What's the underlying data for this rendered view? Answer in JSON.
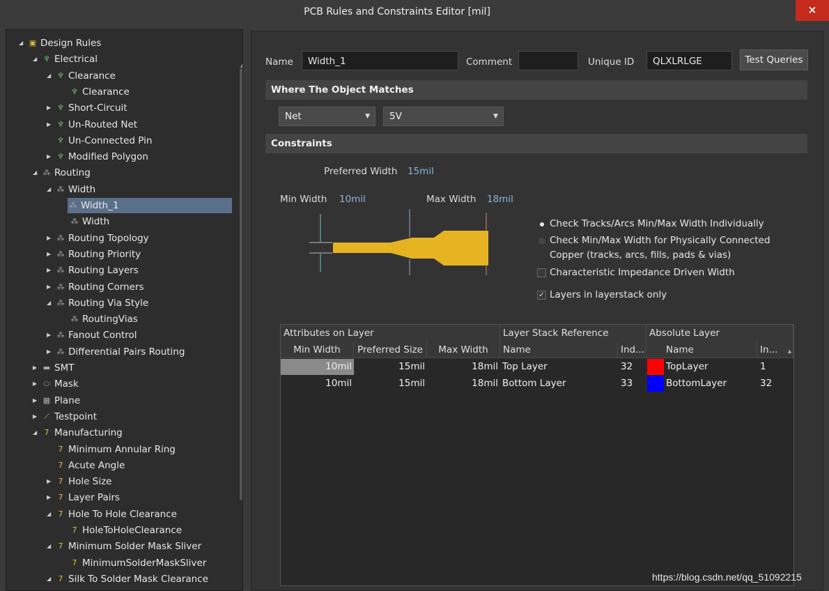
{
  "window": {
    "title": "PCB Rules and Constraints Editor [mil]",
    "close_glyph": "×"
  },
  "tree": [
    {
      "label": "Design Rules",
      "depth": 0,
      "arrow": "open",
      "icon": "folder-rules-icon",
      "glyph": "▣"
    },
    {
      "label": "Electrical",
      "depth": 1,
      "arrow": "open",
      "icon": "electrical-rule-icon",
      "glyph": "♆"
    },
    {
      "label": "Clearance",
      "depth": 2,
      "arrow": "open",
      "icon": "electrical-rule-icon",
      "glyph": "♆"
    },
    {
      "label": "Clearance",
      "depth": 3,
      "arrow": "none",
      "icon": "electrical-rule-icon",
      "glyph": "♆"
    },
    {
      "label": "Short-Circuit",
      "depth": 2,
      "arrow": "closed",
      "icon": "electrical-rule-icon",
      "glyph": "♆"
    },
    {
      "label": "Un-Routed Net",
      "depth": 2,
      "arrow": "closed",
      "icon": "electrical-rule-icon",
      "glyph": "♆"
    },
    {
      "label": "Un-Connected Pin",
      "depth": 2,
      "arrow": "none",
      "icon": "electrical-rule-icon",
      "glyph": "♆"
    },
    {
      "label": "Modified Polygon",
      "depth": 2,
      "arrow": "closed",
      "icon": "electrical-rule-icon",
      "glyph": "♆"
    },
    {
      "label": "Routing",
      "depth": 1,
      "arrow": "open",
      "icon": "routing-rule-icon",
      "glyph": "⁂"
    },
    {
      "label": "Width",
      "depth": 2,
      "arrow": "open",
      "icon": "routing-rule-icon",
      "glyph": "⁂"
    },
    {
      "label": "Width_1",
      "depth": 3,
      "arrow": "none",
      "icon": "routing-rule-icon",
      "glyph": "⁂",
      "selected": true
    },
    {
      "label": "Width",
      "depth": 3,
      "arrow": "none",
      "icon": "routing-rule-icon",
      "glyph": "⁂"
    },
    {
      "label": "Routing Topology",
      "depth": 2,
      "arrow": "closed",
      "icon": "routing-rule-icon",
      "glyph": "⁂"
    },
    {
      "label": "Routing Priority",
      "depth": 2,
      "arrow": "closed",
      "icon": "routing-rule-icon",
      "glyph": "⁂"
    },
    {
      "label": "Routing Layers",
      "depth": 2,
      "arrow": "closed",
      "icon": "routing-rule-icon",
      "glyph": "⁂"
    },
    {
      "label": "Routing Corners",
      "depth": 2,
      "arrow": "closed",
      "icon": "routing-rule-icon",
      "glyph": "⁂"
    },
    {
      "label": "Routing Via Style",
      "depth": 2,
      "arrow": "open",
      "icon": "routing-rule-icon",
      "glyph": "⁂"
    },
    {
      "label": "RoutingVias",
      "depth": 3,
      "arrow": "none",
      "icon": "routing-rule-icon",
      "glyph": "⁂"
    },
    {
      "label": "Fanout Control",
      "depth": 2,
      "arrow": "closed",
      "icon": "routing-rule-icon",
      "glyph": "⁂"
    },
    {
      "label": "Differential Pairs Routing",
      "depth": 2,
      "arrow": "closed",
      "icon": "routing-rule-icon",
      "glyph": "⁂"
    },
    {
      "label": "SMT",
      "depth": 1,
      "arrow": "closed",
      "icon": "smt-rule-icon",
      "glyph": "▬"
    },
    {
      "label": "Mask",
      "depth": 1,
      "arrow": "closed",
      "icon": "mask-rule-icon",
      "glyph": "⬭"
    },
    {
      "label": "Plane",
      "depth": 1,
      "arrow": "closed",
      "icon": "plane-rule-icon",
      "glyph": "▦"
    },
    {
      "label": "Testpoint",
      "depth": 1,
      "arrow": "closed",
      "icon": "testpoint-rule-icon",
      "glyph": "⟋"
    },
    {
      "label": "Manufacturing",
      "depth": 1,
      "arrow": "open",
      "icon": "manufacturing-rule-icon",
      "glyph": "7"
    },
    {
      "label": "Minimum Annular Ring",
      "depth": 2,
      "arrow": "none",
      "icon": "manufacturing-rule-icon",
      "glyph": "7"
    },
    {
      "label": "Acute Angle",
      "depth": 2,
      "arrow": "none",
      "icon": "manufacturing-rule-icon",
      "glyph": "7"
    },
    {
      "label": "Hole Size",
      "depth": 2,
      "arrow": "closed",
      "icon": "manufacturing-rule-icon",
      "glyph": "7"
    },
    {
      "label": "Layer Pairs",
      "depth": 2,
      "arrow": "closed",
      "icon": "manufacturing-rule-icon",
      "glyph": "7"
    },
    {
      "label": "Hole To Hole Clearance",
      "depth": 2,
      "arrow": "open",
      "icon": "manufacturing-rule-icon",
      "glyph": "7"
    },
    {
      "label": "HoleToHoleClearance",
      "depth": 3,
      "arrow": "none",
      "icon": "manufacturing-rule-icon",
      "glyph": "7"
    },
    {
      "label": "Minimum Solder Mask Sliver",
      "depth": 2,
      "arrow": "open",
      "icon": "manufacturing-rule-icon",
      "glyph": "7"
    },
    {
      "label": "MinimumSolderMaskSliver",
      "depth": 3,
      "arrow": "none",
      "icon": "manufacturing-rule-icon",
      "glyph": "7"
    },
    {
      "label": "Silk To Solder Mask Clearance",
      "depth": 2,
      "arrow": "open",
      "icon": "manufacturing-rule-icon",
      "glyph": "7"
    }
  ],
  "header": {
    "name_label": "Name",
    "name_value": "Width_1",
    "comment_label": "Comment",
    "comment_value": "",
    "uid_label": "Unique ID",
    "uid_value": "QLXLRLGE",
    "test_queries": "Test Queries"
  },
  "match": {
    "title": "Where The Object Matches",
    "kind": "Net",
    "value": "5V"
  },
  "constraints": {
    "title": "Constraints",
    "preferred_label": "Preferred Width",
    "preferred_value": "15mil",
    "min_label": "Min Width",
    "min_value": "10mil",
    "max_label": "Max Width",
    "max_value": "18mil",
    "trace_color": "#e6b422",
    "options": [
      {
        "type": "radio",
        "checked": true,
        "text": "Check Tracks/Arcs Min/Max Width Individually"
      },
      {
        "type": "radio",
        "checked": false,
        "text": "Check Min/Max Width for Physically Connected Copper (tracks, arcs, fills, pads & vias)"
      },
      {
        "type": "checkbox",
        "checked": false,
        "text": "Characteristic Impedance Driven Width"
      },
      {
        "type": "checkbox",
        "checked": true,
        "text": "Layers in layerstack only"
      }
    ]
  },
  "table": {
    "groups": [
      "Attributes on Layer",
      "Layer Stack Reference",
      "Absolute Layer"
    ],
    "columns": [
      "Min Width",
      "Preferred Size",
      "Max Width",
      "Name",
      "Ind...",
      "Name",
      "In..."
    ],
    "rows": [
      {
        "min": "10mil",
        "pref": "15mil",
        "max": "18mil",
        "stack_name": "Top Layer",
        "stack_idx": "32",
        "color": "#ff0000",
        "abs_name": "TopLayer",
        "abs_idx": "1"
      },
      {
        "min": "10mil",
        "pref": "15mil",
        "max": "18mil",
        "stack_name": "Bottom Layer",
        "stack_idx": "33",
        "color": "#0000ff",
        "abs_name": "BottomLayer",
        "abs_idx": "32"
      }
    ]
  },
  "watermark": "https://blog.csdn.net/qq_51092215"
}
